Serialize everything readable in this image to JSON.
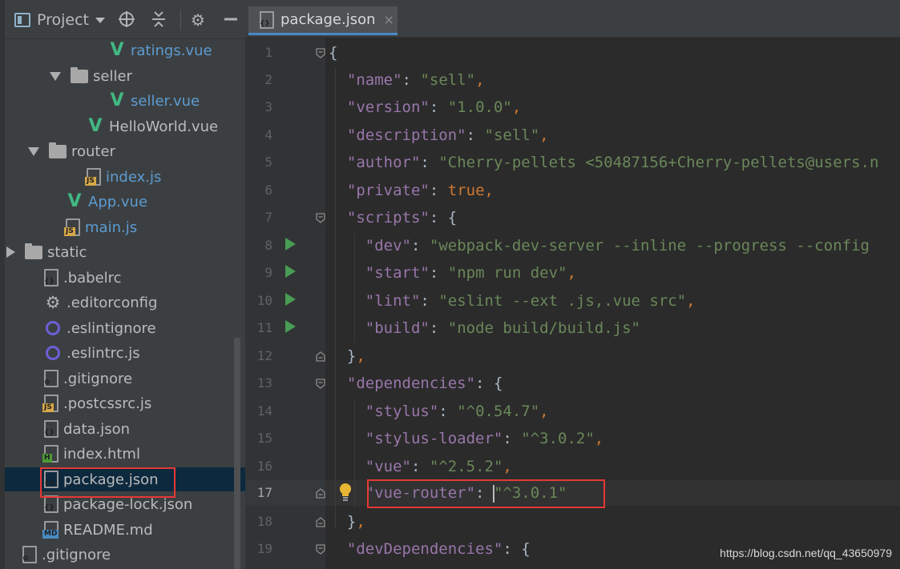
{
  "project_panel": {
    "title": "Project",
    "toolbar_icons": [
      "target-icon",
      "collapse-icon",
      "gear-icon",
      "hide-icon"
    ],
    "tree": [
      {
        "label": "ratings.vue",
        "icon": "vue-icon",
        "kind": "vue"
      },
      {
        "label": "seller",
        "icon": "folder-icon",
        "kind": "folder",
        "expanded": true
      },
      {
        "label": "seller.vue",
        "icon": "vue-icon",
        "kind": "vue"
      },
      {
        "label": "HelloWorld.vue",
        "icon": "vue-icon",
        "kind": "vue-plain"
      },
      {
        "label": "router",
        "icon": "folder-icon",
        "kind": "folder",
        "expanded": true
      },
      {
        "label": "index.js",
        "icon": "js-file-icon",
        "kind": "js"
      },
      {
        "label": "App.vue",
        "icon": "vue-icon",
        "kind": "vue"
      },
      {
        "label": "main.js",
        "icon": "js-file-icon",
        "kind": "js"
      },
      {
        "label": "static",
        "icon": "folder-icon",
        "kind": "folder",
        "expanded": false
      },
      {
        "label": ".babelrc",
        "icon": "config-file-icon",
        "kind": "cfg"
      },
      {
        "label": ".editorconfig",
        "icon": "gear-icon",
        "kind": "gear"
      },
      {
        "label": ".eslintignore",
        "icon": "eslint-icon",
        "kind": "eslint"
      },
      {
        "label": ".eslintrc.js",
        "icon": "eslint-icon",
        "kind": "eslint"
      },
      {
        "label": ".gitignore",
        "icon": "ignore-file-icon",
        "kind": "git"
      },
      {
        "label": ".postcssrc.js",
        "icon": "js-file-icon",
        "kind": "js-plain"
      },
      {
        "label": "data.json",
        "icon": "json-file-icon",
        "kind": "cfg"
      },
      {
        "label": "index.html",
        "icon": "html-file-icon",
        "kind": "html"
      },
      {
        "label": "package.json",
        "icon": "json-file-icon",
        "kind": "cfg",
        "selected": true
      },
      {
        "label": "package-lock.json",
        "icon": "json-file-icon",
        "kind": "cfg"
      },
      {
        "label": "README.md",
        "icon": "markdown-file-icon",
        "kind": "md"
      },
      {
        "label": ".gitignore",
        "icon": "ignore-file-icon",
        "kind": "git"
      }
    ]
  },
  "editor": {
    "tab": {
      "label": "package.json",
      "close": "×"
    },
    "current_line": 17,
    "lines": [
      {
        "n": "1",
        "text": "{"
      },
      {
        "n": "2",
        "text": "  \"name\": \"sell\","
      },
      {
        "n": "3",
        "text": "  \"version\": \"1.0.0\","
      },
      {
        "n": "4",
        "text": "  \"description\": \"sell\","
      },
      {
        "n": "5",
        "text": "  \"author\": \"Cherry-pellets <50487156+Cherry-pellets@users.n"
      },
      {
        "n": "6",
        "text": "  \"private\": true,"
      },
      {
        "n": "7",
        "text": "  \"scripts\": {"
      },
      {
        "n": "8",
        "text": "    \"dev\": \"webpack-dev-server --inline --progress --config"
      },
      {
        "n": "9",
        "text": "    \"start\": \"npm run dev\","
      },
      {
        "n": "10",
        "text": "    \"lint\": \"eslint --ext .js,.vue src\","
      },
      {
        "n": "11",
        "text": "    \"build\": \"node build/build.js\""
      },
      {
        "n": "12",
        "text": "  },"
      },
      {
        "n": "13",
        "text": "  \"dependencies\": {"
      },
      {
        "n": "14",
        "text": "    \"stylus\": \"^0.54.7\","
      },
      {
        "n": "15",
        "text": "    \"stylus-loader\": \"^3.0.2\","
      },
      {
        "n": "16",
        "text": "    \"vue\": \"^2.5.2\","
      },
      {
        "n": "17",
        "text": "    \"vue-router\": \"^3.0.1\""
      },
      {
        "n": "18",
        "text": "  },"
      },
      {
        "n": "19",
        "text": "  \"devDependencies\": {"
      }
    ]
  },
  "watermark": "https://blog.csdn.net/qq_43650979",
  "colors": {
    "accent": "#4a88c7",
    "highlight_box": "#e53935",
    "key": "#9876aa",
    "string": "#6a8759",
    "punct": "#cc7832",
    "vue_green": "#41b883",
    "run_green": "#499c54"
  }
}
